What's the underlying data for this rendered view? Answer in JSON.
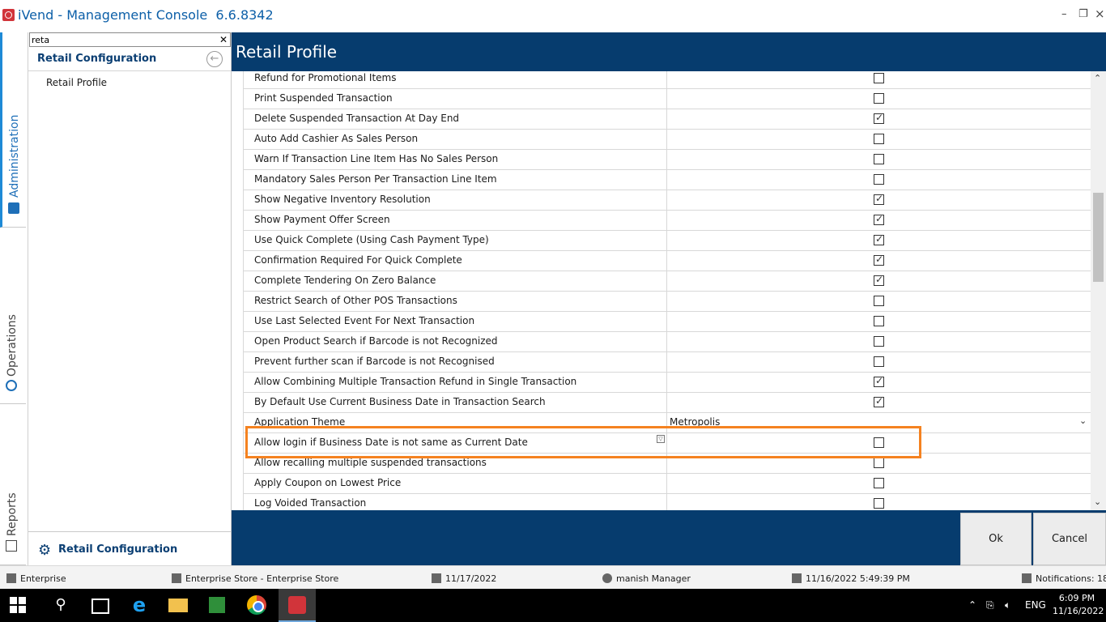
{
  "window": {
    "title": "iVend - Management Console  6.6.8342",
    "controls": [
      "minimize",
      "restore",
      "close"
    ]
  },
  "vertical_tabs": [
    {
      "label": "Administration",
      "icon": "briefcase-icon",
      "active": true
    },
    {
      "label": "Operations",
      "icon": "gear-icon",
      "active": false
    },
    {
      "label": "Reports",
      "icon": "report-icon",
      "active": false
    }
  ],
  "nav": {
    "search_value": "reta",
    "header_title": "Retail Configuration",
    "items": [
      "Retail Profile"
    ],
    "footer_label": "Retail Configuration"
  },
  "main": {
    "title": "Retail Profile",
    "rows": [
      {
        "label": "Refund for Promotional Items",
        "checked": false
      },
      {
        "label": "Print Suspended Transaction",
        "checked": false
      },
      {
        "label": "Delete Suspended Transaction At Day End",
        "checked": true
      },
      {
        "label": "Auto Add Cashier As Sales Person",
        "checked": false
      },
      {
        "label": "Warn If Transaction Line Item Has No Sales Person",
        "checked": false
      },
      {
        "label": "Mandatory Sales Person Per Transaction Line Item",
        "checked": false
      },
      {
        "label": "Show Negative Inventory Resolution",
        "checked": true
      },
      {
        "label": "Show Payment Offer Screen",
        "checked": true
      },
      {
        "label": "Use Quick Complete (Using Cash Payment Type)",
        "checked": true
      },
      {
        "label": "Confirmation Required For Quick Complete",
        "checked": true
      },
      {
        "label": "Complete Tendering On Zero Balance",
        "checked": true
      },
      {
        "label": "Restrict Search of Other POS Transactions",
        "checked": false
      },
      {
        "label": "Use Last Selected Event For Next Transaction",
        "checked": false
      },
      {
        "label": "Open Product Search if Barcode is not Recognized",
        "checked": false
      },
      {
        "label": "Prevent further scan if Barcode is not Recognised",
        "checked": false
      },
      {
        "label": "Allow Combining Multiple Transaction Refund in Single Transaction",
        "checked": true
      },
      {
        "label": "By Default Use Current Business Date in Transaction Search",
        "checked": true
      },
      {
        "label": "Application Theme",
        "dropdown_value": "Metropolis"
      },
      {
        "label": "Allow login if Business Date is not same as Current Date",
        "checked": false,
        "highlighted": true
      },
      {
        "label": "Allow recalling multiple suspended transactions",
        "checked": false
      },
      {
        "label": "Apply Coupon on Lowest Price",
        "checked": false
      },
      {
        "label": "Log Voided Transaction",
        "checked": false
      }
    ],
    "buttons": {
      "ok": "Ok",
      "cancel": "Cancel"
    },
    "highlight_color": "#f58220"
  },
  "statusbar": {
    "company": "Enterprise",
    "store": "Enterprise Store - Enterprise Store",
    "business_date": "11/17/2022",
    "user": "manish Manager",
    "login_time": "11/16/2022 5:49:39 PM",
    "notifications": "Notifications: 18"
  },
  "taskbar": {
    "apps": [
      "start-icon",
      "search-icon",
      "task-view-icon",
      "internet-explorer-icon",
      "file-explorer-icon",
      "network-app-icon",
      "chrome-icon",
      "ivend-icon"
    ],
    "tray_lang": "ENG",
    "clock_time": "6:09 PM",
    "clock_date": "11/16/2022"
  },
  "colors": {
    "brand_dark": "#063c6e",
    "accent_blue": "#1e6fb8",
    "title_blue": "#0c5fa8"
  }
}
